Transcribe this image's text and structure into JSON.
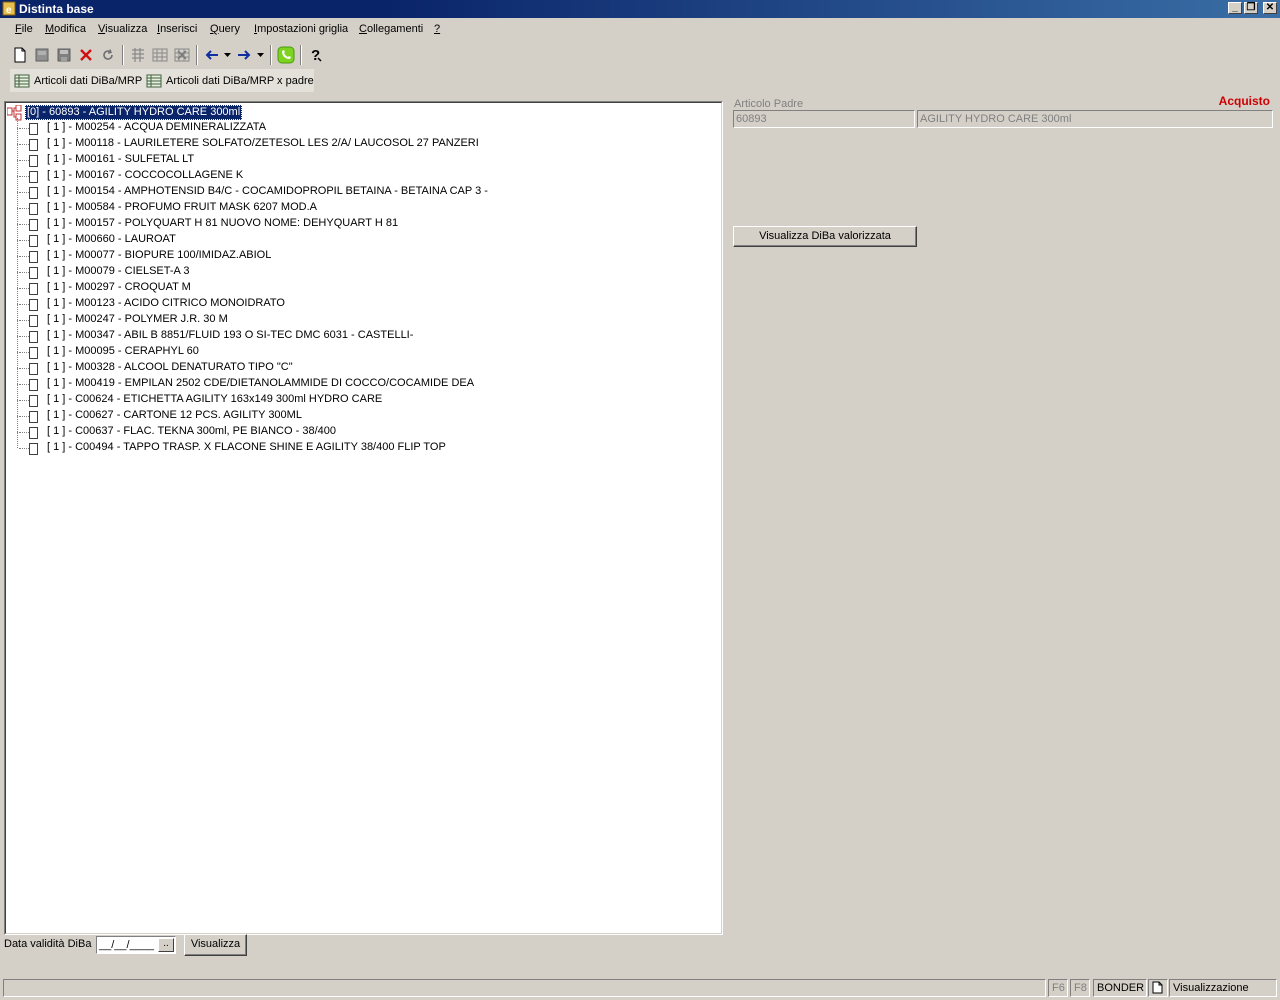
{
  "window": {
    "title": "Distinta base",
    "controls": [
      "_",
      "❐",
      "✕"
    ]
  },
  "menu": {
    "items": [
      {
        "label": "File",
        "underline": "F",
        "rest": "ile"
      },
      {
        "label": "Modifica",
        "underline": "M",
        "rest": "odifica"
      },
      {
        "label": "Visualizza",
        "underline": "V",
        "rest": "isualizza"
      },
      {
        "label": "Inserisci",
        "underline": "I",
        "rest": "nserisci"
      },
      {
        "label": "Query",
        "underline": "Q",
        "rest": "uery"
      },
      {
        "label": "Impostazioni griglia",
        "underline": "I",
        "rest": "mpostazioni griglia"
      },
      {
        "label": "Collegamenti",
        "underline": "C",
        "rest": "ollegamenti"
      },
      {
        "label": "?",
        "underline": "?",
        "rest": ""
      }
    ]
  },
  "toolbar2": {
    "btn1": "Articoli dati DiBa/MRP",
    "btn2": "Articoli dati DiBa/MRP x padre"
  },
  "tree": {
    "root": "[0] - 60893 - AGILITY HYDRO CARE  300ml",
    "children": [
      "[ 1 ] - M00254 - ACQUA DEMINERALIZZATA",
      "[ 1 ] - M00118 - LAURILETERE SOLFATO/ZETESOL LES 2/A/ LAUCOSOL 27 PANZERI",
      "[ 1 ] - M00161 - SULFETAL LT",
      "[ 1 ] - M00167 - COCCOCOLLAGENE K",
      "[ 1 ] - M00154 - AMPHOTENSID B4/C - COCAMIDOPROPIL BETAINA  - BETAINA CAP 3 -",
      "[ 1 ] - M00584 - PROFUMO FRUIT MASK 6207 MOD.A",
      "[ 1 ] - M00157 - POLYQUART H 81 NUOVO NOME: DEHYQUART H 81",
      "[ 1 ] - M00660 - LAUROAT",
      "[ 1 ] - M00077 - BIOPURE 100/IMIDAZ.ABIOL",
      "[ 1 ] - M00079 - CIELSET-A 3",
      "[ 1 ] - M00297 - CROQUAT M",
      "[ 1 ] - M00123 - ACIDO CITRICO MONOIDRATO",
      "[ 1 ] - M00247 - POLYMER J.R. 30 M",
      "[ 1 ] - M00347 - ABIL B 8851/FLUID 193 O SI-TEC DMC 6031 - CASTELLI-",
      "[ 1 ] - M00095 - CERAPHYL 60",
      "[ 1 ] - M00328 - ALCOOL DENATURATO TIPO \"C\"",
      "[ 1 ] - M00419 - EMPILAN 2502 CDE/DIETANOLAMMIDE DI COCCO/COCAMIDE DEA",
      "[ 1 ] - C00624 - ETICHETTA AGILITY 163x149 300ml HYDRO CARE",
      "[ 1 ] - C00627 - CARTONE 12 PCS. AGILITY 300ML",
      "[ 1 ] - C00637 - FLAC. TEKNA 300ml, PE BIANCO - 38/400",
      "[ 1 ] - C00494 - TAPPO TRASP. X FLACONE SHINE E AGILITY 38/400 FLIP TOP"
    ]
  },
  "detail": {
    "badge": "Acquisto",
    "padre_label": "Articolo Padre",
    "padre_code": "60893",
    "padre_desc": "AGILITY HYDRO CARE  300ml",
    "btn_visualizza_valorizzata": "Visualizza DiBa valorizzata"
  },
  "bottom": {
    "date_label": "Data validità DiBa",
    "date_value": "__/__/____",
    "date_dropdown": "..",
    "visualizza_btn": "Visualizza"
  },
  "status": {
    "f6": "F6",
    "f8": "F8",
    "user": "BONDER",
    "mode": "Visualizzazione"
  },
  "colors": {
    "titlebar": "#0a246a",
    "selection": "#0a246a",
    "badge": "#cc0000",
    "face": "#d4d0c8"
  }
}
